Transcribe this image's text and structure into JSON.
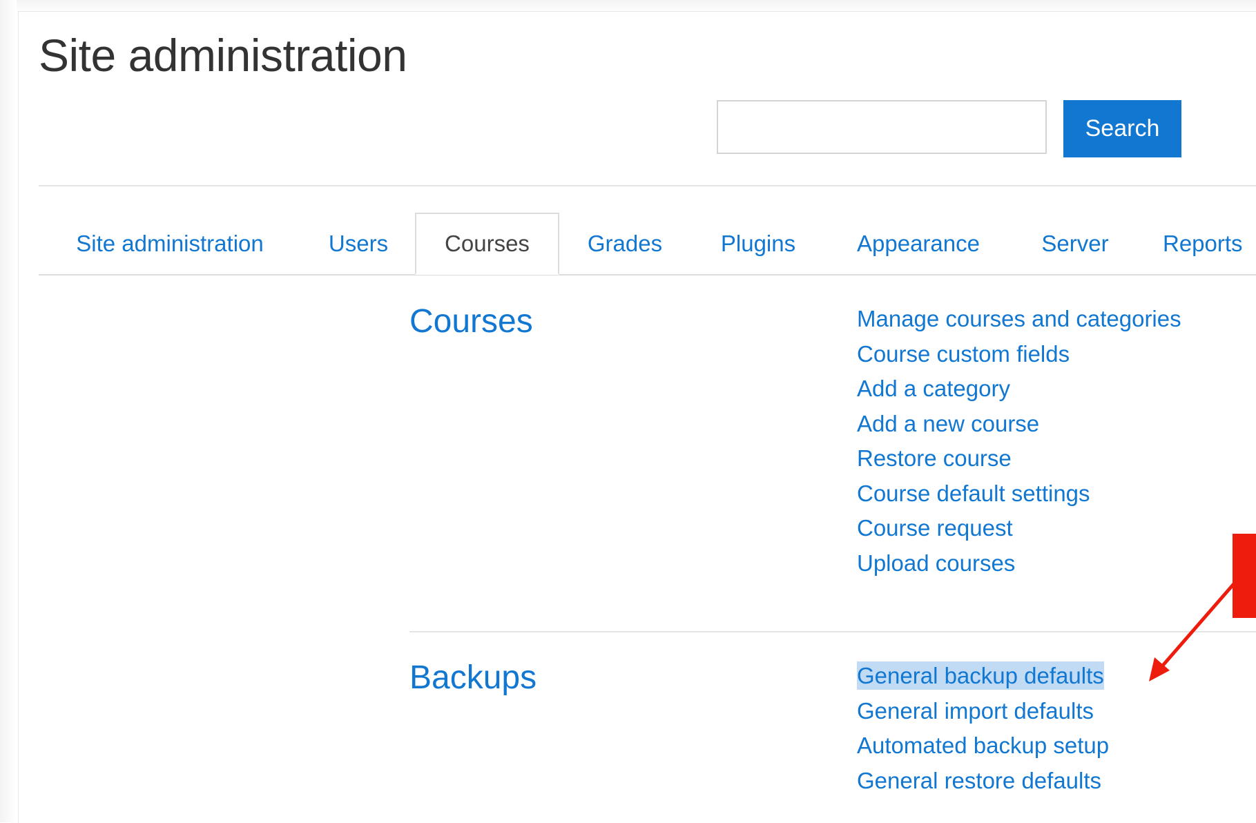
{
  "page": {
    "title": "Site administration"
  },
  "search": {
    "value": "",
    "placeholder": "",
    "button_label": "Search"
  },
  "tabs": [
    {
      "label": "Site administration",
      "active": false
    },
    {
      "label": "Users",
      "active": false
    },
    {
      "label": "Courses",
      "active": true
    },
    {
      "label": "Grades",
      "active": false
    },
    {
      "label": "Plugins",
      "active": false
    },
    {
      "label": "Appearance",
      "active": false
    },
    {
      "label": "Server",
      "active": false
    },
    {
      "label": "Reports",
      "active": false
    }
  ],
  "sections": [
    {
      "heading": "Courses",
      "links": [
        "Manage courses and categories",
        "Course custom fields",
        "Add a category",
        "Add a new course",
        "Restore course",
        "Course default settings",
        "Course request",
        "Upload courses"
      ]
    },
    {
      "heading": "Backups",
      "links": [
        "General backup defaults",
        "General import defaults",
        "Automated backup setup",
        "General restore defaults"
      ],
      "highlighted_link": "General backup defaults"
    }
  ],
  "colors": {
    "link": "#1177d1",
    "button_bg": "#1177d1",
    "highlight_bg": "#c2dbf5",
    "annotation": "#ee1c0d",
    "title_text": "#333333"
  },
  "annotation": {
    "type": "arrow",
    "icon": "red-arrow-icon"
  }
}
